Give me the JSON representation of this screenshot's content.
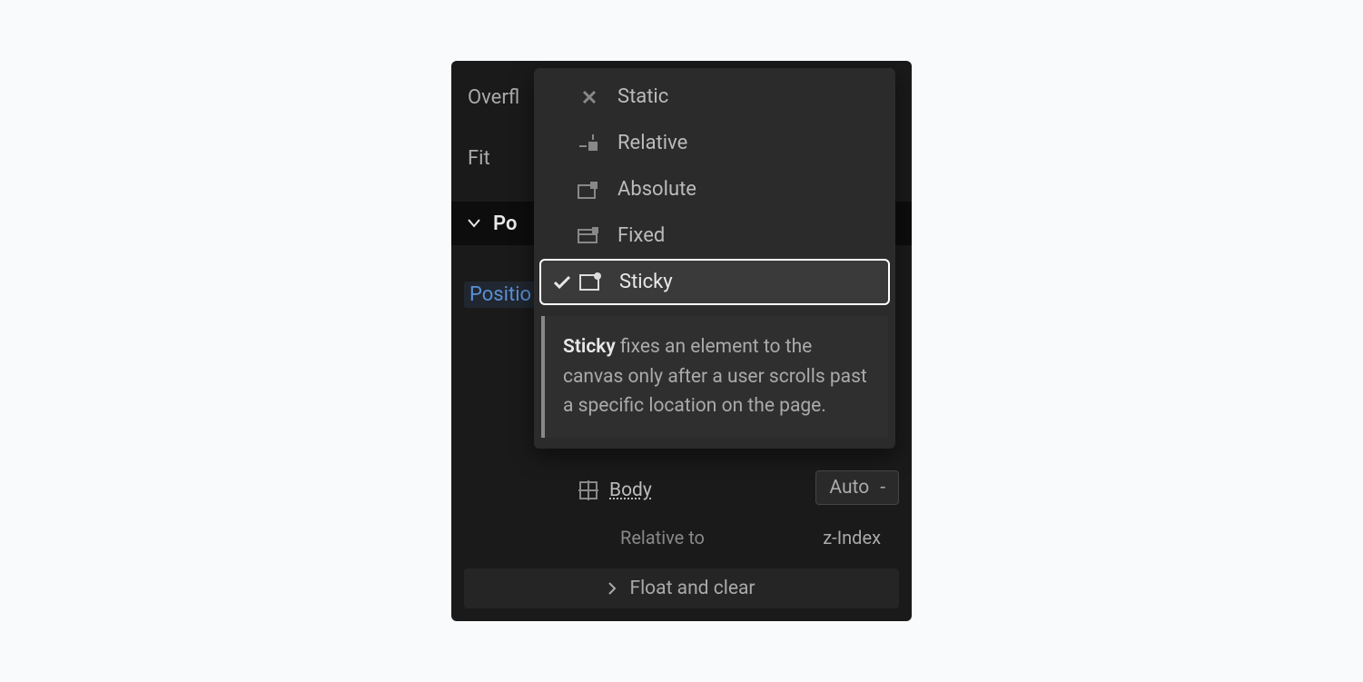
{
  "panel": {
    "overflow_label": "Overfl",
    "fit_label": "Fit",
    "section_title": "Po",
    "position_label": "Positio"
  },
  "dropdown": {
    "items": [
      {
        "label": "Static",
        "selected": false
      },
      {
        "label": "Relative",
        "selected": false
      },
      {
        "label": "Absolute",
        "selected": false
      },
      {
        "label": "Fixed",
        "selected": false
      },
      {
        "label": "Sticky",
        "selected": true
      }
    ],
    "tooltip_strong": "Sticky",
    "tooltip_text": " fixes an element to the canvas only after a user scrolls past a specific location on the page."
  },
  "bottom": {
    "body_label": "Body",
    "auto_label": "Auto",
    "auto_suffix": "-",
    "relative_to": "Relative to",
    "z_index": "z-Index",
    "float_clear": "Float and clear"
  }
}
